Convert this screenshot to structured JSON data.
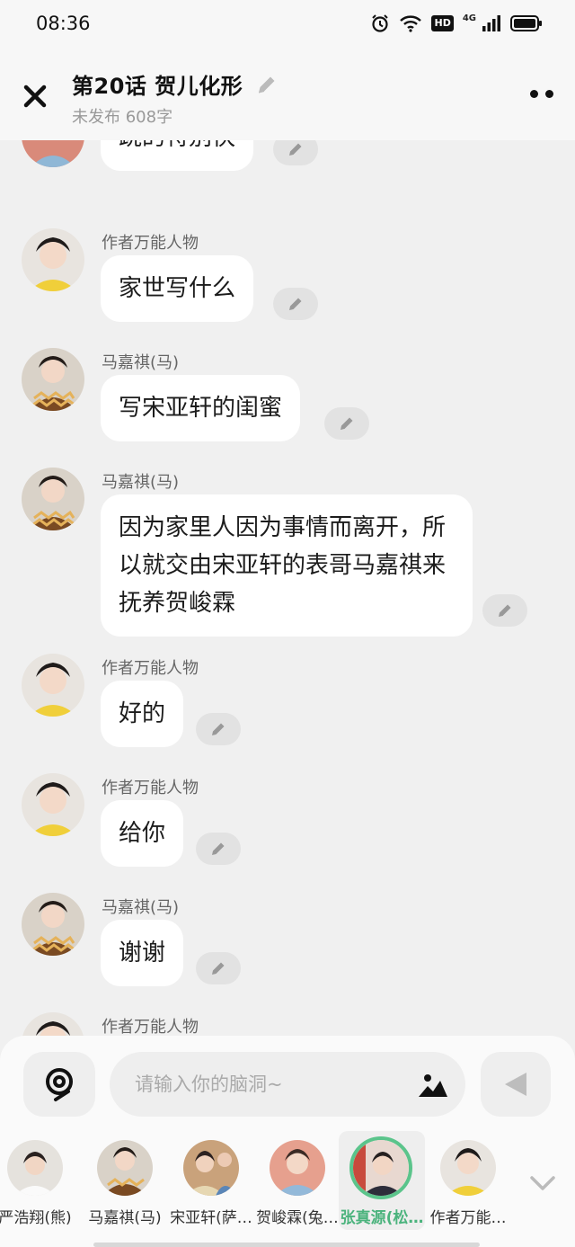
{
  "status_bar": {
    "time": "08:36",
    "hd": "HD",
    "network": "4G"
  },
  "header": {
    "title": "第20话  贺儿化形",
    "subtitle": "未发布 608字"
  },
  "messages": [
    {
      "speaker": "",
      "text": "跳的特别快"
    },
    {
      "speaker": "作者万能人物",
      "text": "家世写什么"
    },
    {
      "speaker": "马嘉祺(马)",
      "text": "写宋亚轩的闺蜜"
    },
    {
      "speaker": "马嘉祺(马)",
      "text": "因为家里人因为事情而离开，所以就交由宋亚轩的表哥马嘉祺来抚养贺峻霖"
    },
    {
      "speaker": "作者万能人物",
      "text": "好的"
    },
    {
      "speaker": "作者万能人物",
      "text": "给你"
    },
    {
      "speaker": "马嘉祺(马)",
      "text": "谢谢"
    },
    {
      "speaker": "作者万能人物",
      "text": ""
    }
  ],
  "input": {
    "placeholder": "请输入你的脑洞~"
  },
  "characters": [
    {
      "name": "严浩翔(熊)"
    },
    {
      "name": "马嘉祺(马)"
    },
    {
      "name": "宋亚轩(萨…"
    },
    {
      "name": "贺峻霖(兔…"
    },
    {
      "name": "张真源(松…"
    },
    {
      "name": "作者万能…"
    }
  ],
  "colors": {
    "selected": "#4bb37d",
    "bubble": "#ffffff",
    "background": "#f0f0f0"
  }
}
